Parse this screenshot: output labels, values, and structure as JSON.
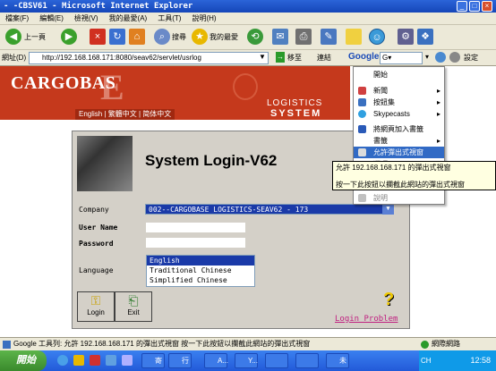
{
  "window": {
    "title": "- -CBSV61 - Microsoft Internet Explorer"
  },
  "menubar": {
    "items": [
      "檔案(F)",
      "編輯(E)",
      "檢視(V)",
      "我的最愛(A)",
      "工具(T)",
      "說明(H)"
    ]
  },
  "toolbar": {
    "back": "上一頁",
    "search": "搜尋",
    "favorites": "我的最愛"
  },
  "addressbar": {
    "label": "網址(D)",
    "url": "http://192.168.168.171:8080/seav62/servlet/usrlog",
    "go": "移至",
    "links": "連結",
    "google": "Google",
    "settings": "設定"
  },
  "banner": {
    "logo": "CARGOBAS",
    "logo_e": "E",
    "logistics": "LOGISTICS",
    "system": "SYSTEM",
    "lang_links": "English | 繁體中文 | 简体中文"
  },
  "login": {
    "title": "System Login-V62",
    "company_label": "Company",
    "company_value": "002--CARGOBASE LOGISTICS-SEAV62 - 173",
    "username_label": "User Name",
    "password_label": "Password",
    "language_label": "Language",
    "languages": [
      "English",
      "Traditional Chinese",
      "Simplified Chinese"
    ],
    "login_button": "Login",
    "exit_button": "Exit",
    "login_problem": "Login Problem"
  },
  "context_menu": {
    "items": [
      {
        "label": "開始",
        "arrow": ""
      },
      {
        "label": "新聞",
        "arrow": "▸"
      },
      {
        "label": "按鈕集",
        "arrow": "▸"
      },
      {
        "label": "Skypecasts",
        "arrow": "▸"
      },
      {
        "label": "將網頁加入書籤",
        "arrow": ""
      },
      {
        "label": "書籤",
        "arrow": "▸"
      },
      {
        "label": "允許彈出式視窗",
        "arrow": ""
      },
      {
        "label": "選項",
        "arrow": ""
      },
      {
        "label": "說明",
        "arrow": ""
      }
    ]
  },
  "tooltip": {
    "line1": "允許 192.168.168.171 的彈出式視窗",
    "line2": "按一下此按鈕以攔截此網站的彈出式視窗"
  },
  "statusbar": {
    "text": "Google 工具列: 允許 192.168.168.171 的彈出式視窗 按一下此按鈕以攔截此網站的彈出式視窗",
    "zone": "網際網路"
  },
  "taskbar": {
    "start": "開始",
    "tasks": [
      "寄",
      "行",
      "A...",
      "Y...",
      "",
      "",
      "未"
    ],
    "lang": "CH",
    "time": "12:58"
  }
}
